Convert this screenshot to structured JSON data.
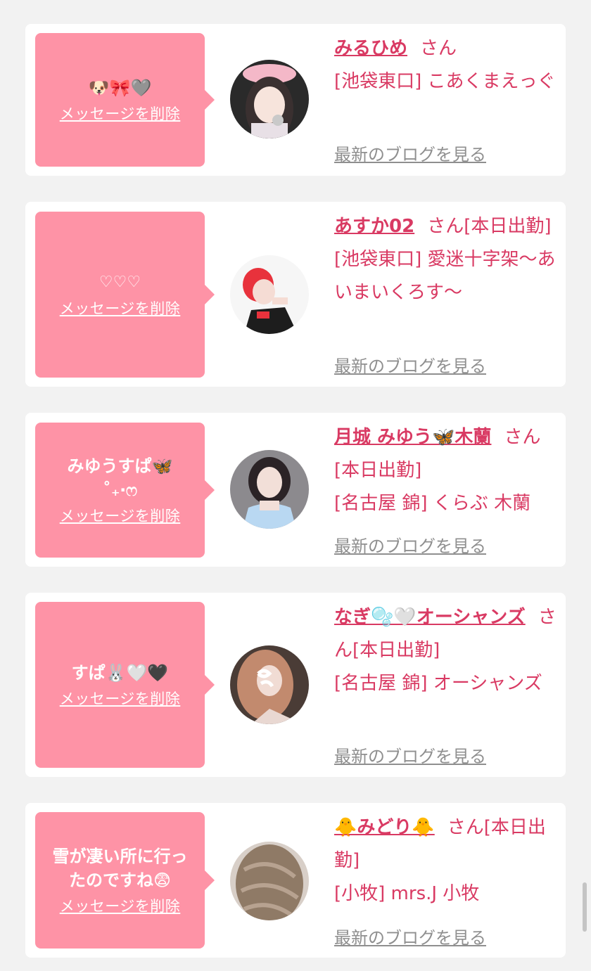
{
  "cards": [
    {
      "message": "🐶🎀🩶",
      "delete_label": "メッセージを削除",
      "name": "みるひめ",
      "honorific": "さん",
      "shop_line": "[池袋東口] こあくまえっぐ",
      "blog_link": "最新のブログを見る"
    },
    {
      "message": "♡♡♡",
      "delete_label": "メッセージを削除",
      "name": "あすか02",
      "honorific": "さん[本日出勤]",
      "shop_line": "[池袋東口] 愛迷十字架〜あいまいくろす〜",
      "blog_link": "最新のブログを見る"
    },
    {
      "message": "みゆうすぱ🦋 ˚₊‧ෆ",
      "delete_label": "メッセージを削除",
      "name": "月城 みゆう🦋木蘭",
      "honorific": "さん[本日出勤]",
      "shop_line": "[名古屋 錦] くらぶ 木蘭",
      "blog_link": "最新のブログを見る"
    },
    {
      "message": "すぱ🐰🤍🖤",
      "delete_label": "メッセージを削除",
      "name": "なぎ🫧🤍オーシャンズ",
      "honorific": "さん[本日出勤]",
      "shop_line": "[名古屋 錦] オーシャンズ",
      "blog_link": "最新のブログを見る"
    },
    {
      "message": "雪が凄い所に行ったのですね😨",
      "delete_label": "メッセージを削除",
      "name": "🐥みどり🐥",
      "honorific": "さん[本日出勤]",
      "shop_line": "[小牧] mrs.J 小牧",
      "blog_link": "最新のブログを見る"
    }
  ],
  "colors": {
    "bubble": "#fe93a6",
    "accent": "#d93a63",
    "link_gray": "#8f8f8f",
    "page_bg": "#f2f2f2"
  }
}
